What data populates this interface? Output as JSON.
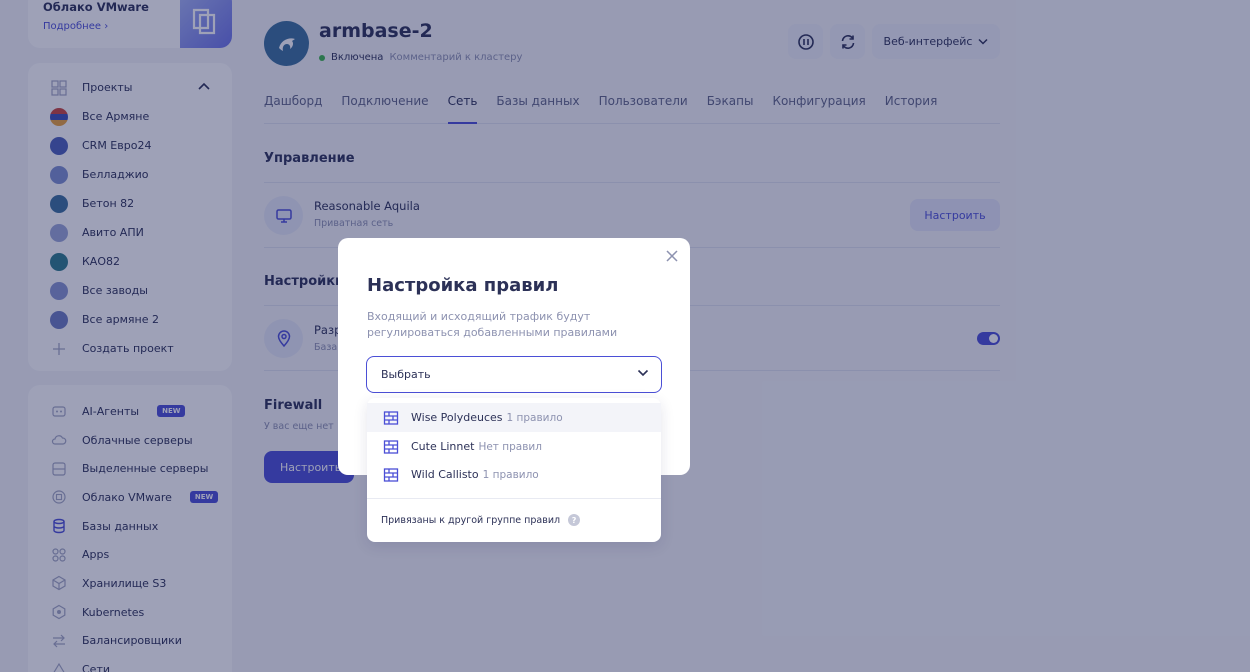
{
  "sidebar": {
    "promo": {
      "title": "Облако VMware",
      "link": "Подробнее"
    },
    "projects": {
      "header": "Проекты",
      "items": [
        {
          "label": "Все Армяне",
          "color": "#c9443b"
        },
        {
          "label": "CRM Евро24",
          "color": "#4a5fb8"
        },
        {
          "label": "Белладжио",
          "color": "#7d8fcf"
        },
        {
          "label": "Бетон 82",
          "color": "#3a6f9c"
        },
        {
          "label": "Авито АПИ",
          "color": "#9aa6d6"
        },
        {
          "label": "КАО82",
          "color": "#2c7a8a"
        },
        {
          "label": "Все заводы",
          "color": "#8795cf"
        },
        {
          "label": "Все армяне 2",
          "color": "#6c7bbf"
        }
      ],
      "create": "Создать проект"
    },
    "services": [
      {
        "label": "AI-Агенты",
        "badge": "NEW",
        "icon": "robot-icon"
      },
      {
        "label": "Облачные серверы",
        "icon": "cloud-icon"
      },
      {
        "label": "Выделенные серверы",
        "icon": "server-icon"
      },
      {
        "label": "Облако VMware",
        "badge": "NEW",
        "icon": "vmware-icon"
      },
      {
        "label": "Базы данных",
        "icon": "database-icon"
      },
      {
        "label": "Apps",
        "icon": "apps-icon"
      },
      {
        "label": "Хранилище S3",
        "icon": "storage-icon"
      },
      {
        "label": "Kubernetes",
        "icon": "kubernetes-icon"
      },
      {
        "label": "Балансировщики",
        "icon": "balancer-icon"
      },
      {
        "label": "Сети",
        "icon": "network-icon"
      }
    ]
  },
  "header": {
    "title": "armbase-2",
    "status": "Включена",
    "comment": "Комментарий к кластеру",
    "web_button": "Веб-интерфейс"
  },
  "tabs": [
    "Дашборд",
    "Подключение",
    "Сеть",
    "Базы данных",
    "Пользователи",
    "Бэкапы",
    "Конфигурация",
    "История"
  ],
  "active_tab": "Сеть",
  "management": {
    "title": "Управление",
    "network_name": "Reasonable Aquila",
    "network_type": "Приватная сеть",
    "configure": "Настроить"
  },
  "settings": {
    "title": "Настройки",
    "row_name": "Разр",
    "row_sub": "База"
  },
  "firewall": {
    "title": "Firewall",
    "sub": "У вас еще нет",
    "button": "Настроить"
  },
  "modal": {
    "title": "Настройка правил",
    "description": "Входящий и исходящий трафик будут регулироваться добавленными правилами",
    "select_placeholder": "Выбрать",
    "options": [
      {
        "name": "Wise Polydeuces",
        "count": "1 правило"
      },
      {
        "name": "Cute Linnet",
        "count": "Нет правил"
      },
      {
        "name": "Wild Callisto",
        "count": "1 правило"
      }
    ],
    "footer": "Привязаны к другой группе правил",
    "help": "?"
  },
  "colors": {
    "accent": "#4b4fd6",
    "status_green": "#3bb54a"
  }
}
